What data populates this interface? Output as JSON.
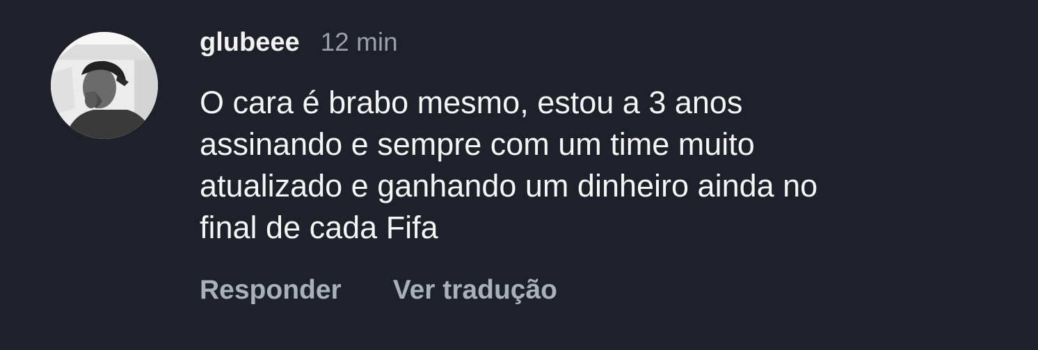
{
  "comment": {
    "username": "glubeee",
    "timestamp": "12 min",
    "text_lines": [
      "O cara é brabo mesmo, estou a 3 anos",
      "assinando e sempre com um time muito",
      "atualizado e ganhando um dinheiro ainda no",
      "final de cada Fifa"
    ],
    "actions": {
      "reply_label": "Responder",
      "translate_label": "Ver tradução"
    }
  },
  "colors": {
    "background": "#1e2129",
    "username": "#f2f2f2",
    "body_text": "#f5f5f5",
    "secondary_text": "#9aa0a8",
    "action_text": "#a8b0bb"
  }
}
